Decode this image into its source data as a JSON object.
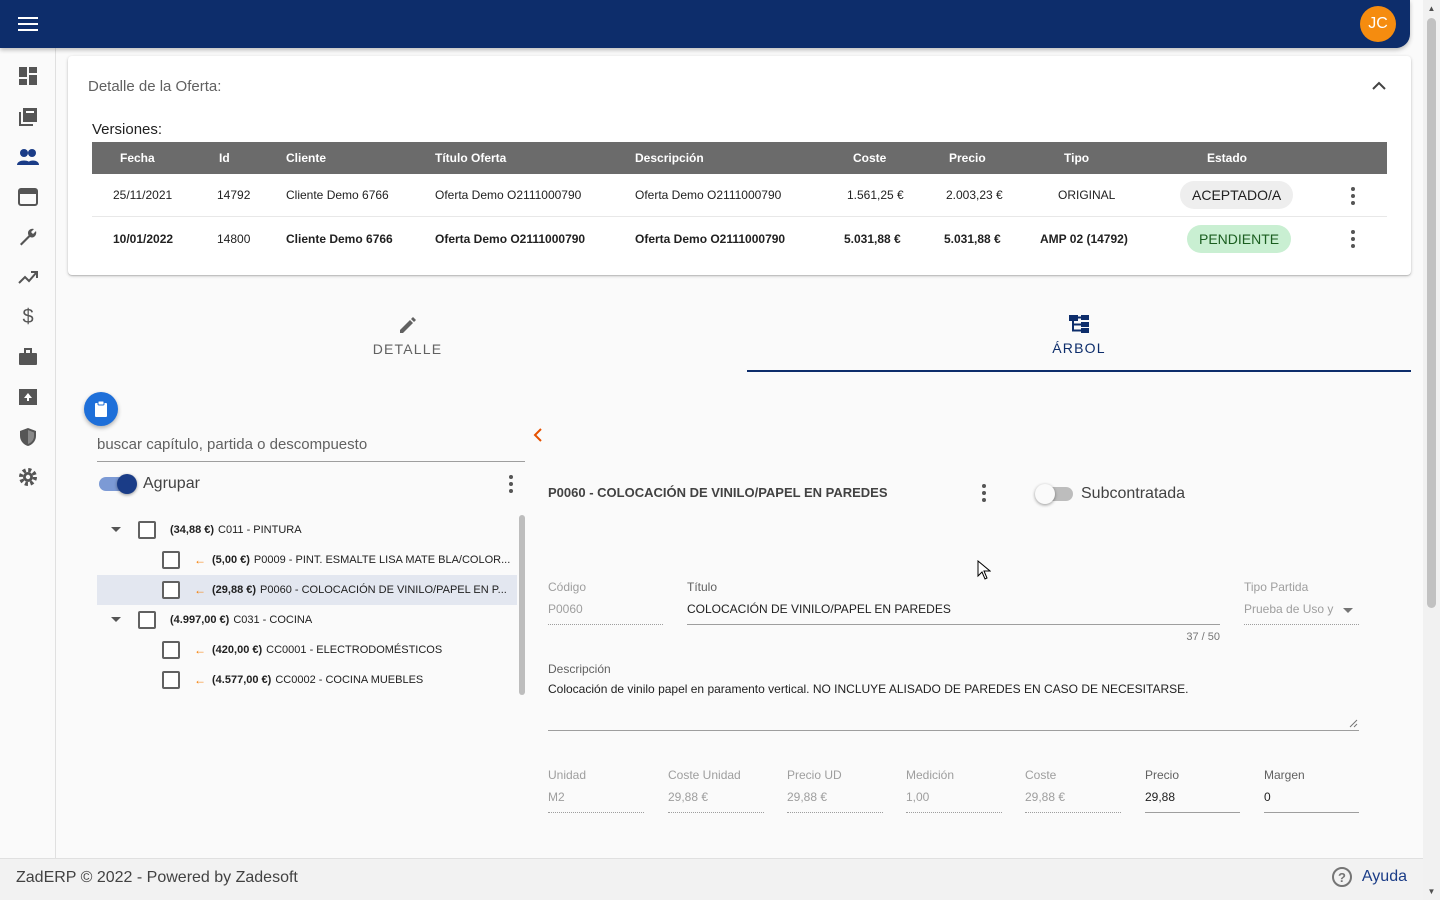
{
  "card": {
    "title": "Detalle de la Oferta:",
    "versions_label": "Versiones:"
  },
  "versions": {
    "columns": [
      "Fecha",
      "Id",
      "Cliente",
      "Título Oferta",
      "Descripción",
      "Coste",
      "Precio",
      "Tipo",
      "Estado"
    ],
    "rows": [
      {
        "fecha": "25/11/2021",
        "id": "14792",
        "cliente": "Cliente Demo 6766",
        "titulo": "Oferta Demo O2111000790",
        "descripcion": "Oferta Demo O2111000790",
        "coste": "1.561,25 €",
        "precio": "2.003,23 €",
        "tipo": "ORIGINAL",
        "estado": "ACEPTADO/A"
      },
      {
        "fecha": "10/01/2022",
        "id": "14800",
        "cliente": "Cliente Demo 6766",
        "titulo": "Oferta Demo O2111000790",
        "descripcion": "Oferta Demo O2111000790",
        "coste": "5.031,88 €",
        "precio": "5.031,88 €",
        "tipo": "AMP 02 (14792)",
        "estado": "PENDIENTE"
      }
    ]
  },
  "user": {
    "initials": "JC"
  },
  "tabs": {
    "detalle": "DETALLE",
    "arbol": "ÁRBOL"
  },
  "tree_panel": {
    "search_placeholder": "buscar capítulo, partida o descompuesto",
    "group_label": "Agrupar",
    "items": [
      {
        "amount": "(34,88 €)",
        "label": "C011 - PINTURA"
      },
      {
        "amount": "(5,00 €)",
        "label": "P0009 - PINT. ESMALTE LISA MATE BLA/COLOR..."
      },
      {
        "amount": "(29,88 €)",
        "label": "P0060 - COLOCACIÓN DE VINILO/PAPEL EN P..."
      },
      {
        "amount": "(4.997,00 €)",
        "label": "C031 - COCINA"
      },
      {
        "amount": "(420,00 €)",
        "label": "CC0001 - ELECTRODOMÉSTICOS"
      },
      {
        "amount": "(4.577,00 €)",
        "label": "CC0002 - COCINA MUEBLES"
      }
    ]
  },
  "detail": {
    "title": "P0060 - COLOCACIÓN DE VINILO/PAPEL EN PAREDES",
    "subcontracted_label": "Subcontratada",
    "codigo": {
      "label": "Código",
      "value": "P0060"
    },
    "titulo": {
      "label": "Título",
      "value": "COLOCACIÓN DE VINILO/PAPEL EN PAREDES",
      "counter": "37 / 50"
    },
    "tipo_partida": {
      "label": "Tipo Partida",
      "value": "Prueba de Uso y"
    },
    "descripcion": {
      "label": "Descripción",
      "value": "Colocación de vinilo papel en paramento vertical. NO INCLUYE ALISADO DE PAREDES EN CASO DE NECESITARSE."
    },
    "unidad": {
      "label": "Unidad",
      "value": "M2"
    },
    "coste_unidad": {
      "label": "Coste Unidad",
      "value": "29,88 €"
    },
    "precio_ud": {
      "label": "Precio UD",
      "value": "29,88 €"
    },
    "medicion": {
      "label": "Medición",
      "value": "1,00"
    },
    "coste": {
      "label": "Coste",
      "value": "29,88 €"
    },
    "precio": {
      "label": "Precio",
      "value": "29,88"
    },
    "margen": {
      "label": "Margen",
      "value": "0"
    }
  },
  "footer": {
    "text": "ZadERP © 2022 - Powered by Zadesoft",
    "help": "Ayuda"
  },
  "colors": {
    "topbar": "#0d2d6b",
    "avatar": "#f58c0f",
    "pending": "#c9efd2",
    "accent": "#1e6fd9"
  },
  "icons": {
    "sidebar": [
      "dashboard-icon",
      "library-icon",
      "people-icon",
      "calendar-view-icon",
      "wrench-icon",
      "trending-up-icon",
      "dollar-icon",
      "briefcase-icon",
      "archive-icon",
      "shield-icon",
      "settings-icon"
    ]
  }
}
